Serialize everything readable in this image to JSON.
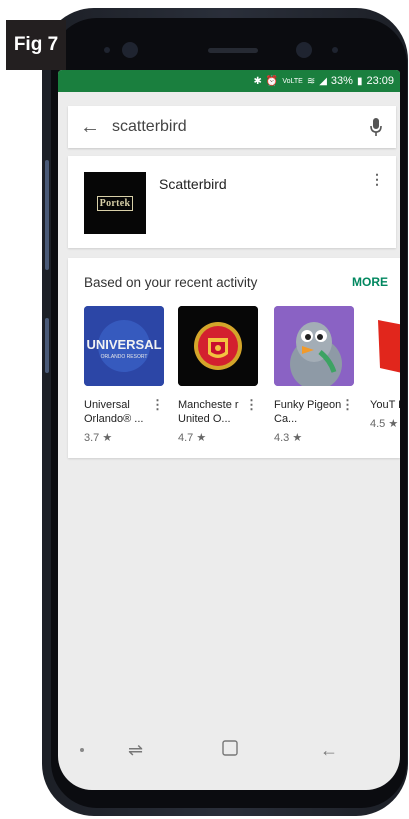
{
  "figure": {
    "label": "Fig 7"
  },
  "status_bar": {
    "icons": [
      "bluetooth-icon",
      "alarm-icon",
      "volte-icon",
      "wifi-icon",
      "signal-icon"
    ],
    "battery_percent": "33%",
    "time": "23:09",
    "background_color": "#1a7f3e"
  },
  "search": {
    "query": "scatterbird"
  },
  "result": {
    "title": "Scatterbird",
    "logo_text": "Portek"
  },
  "recommendations": {
    "heading": "Based on your recent activity",
    "more_label": "MORE",
    "more_color": "#01875f",
    "apps": [
      {
        "name": "Universal Orlando® ...",
        "rating": "3.7 ★",
        "icon": "universal-orlando-icon",
        "logo_text": "UNIVERSAL",
        "logo_subtext": "ORLANDO RESORT"
      },
      {
        "name": "Mancheste r United O...",
        "rating": "4.7 ★",
        "icon": "manchester-united-icon",
        "logo_text": "MANCHESTER UNITED"
      },
      {
        "name": "Funky Pigeon Ca...",
        "rating": "4.3 ★",
        "icon": "funky-pigeon-icon"
      },
      {
        "name": "YouT Kids",
        "rating": "4.5 ★",
        "icon": "youtube-kids-icon"
      }
    ]
  },
  "nav_bar": {
    "icons": [
      "recent-apps-icon",
      "home-icon",
      "back-icon"
    ]
  }
}
